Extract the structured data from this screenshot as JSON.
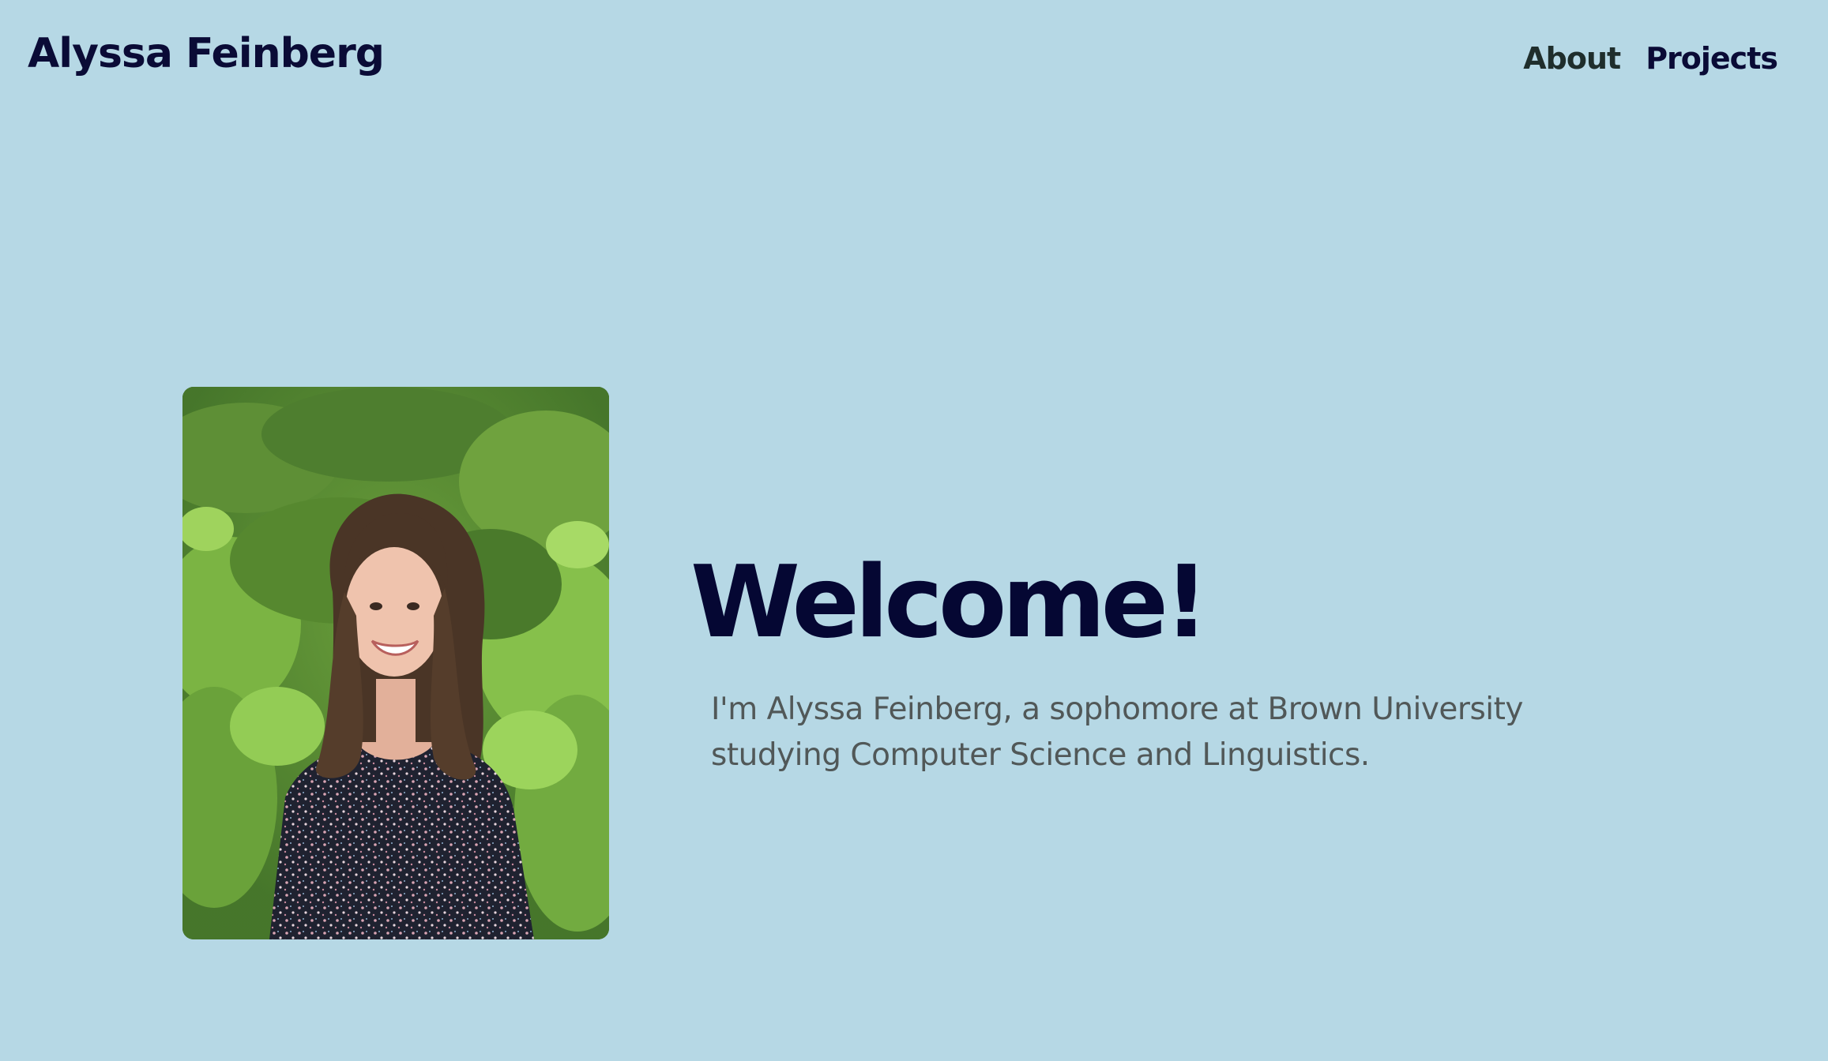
{
  "header": {
    "brand": "Alyssa Feinberg",
    "nav": [
      {
        "label": "About"
      },
      {
        "label": "Projects"
      }
    ]
  },
  "hero": {
    "photo_icon": "portrait-photo",
    "title": "Welcome!",
    "intro": "I'm Alyssa Feinberg, a sophomore at Brown University studying Computer Science and Linguistics."
  },
  "colors": {
    "background": "#b6d8e5",
    "brand_text": "#0a0b36",
    "title_text": "#050733",
    "body_text": "#515858"
  }
}
